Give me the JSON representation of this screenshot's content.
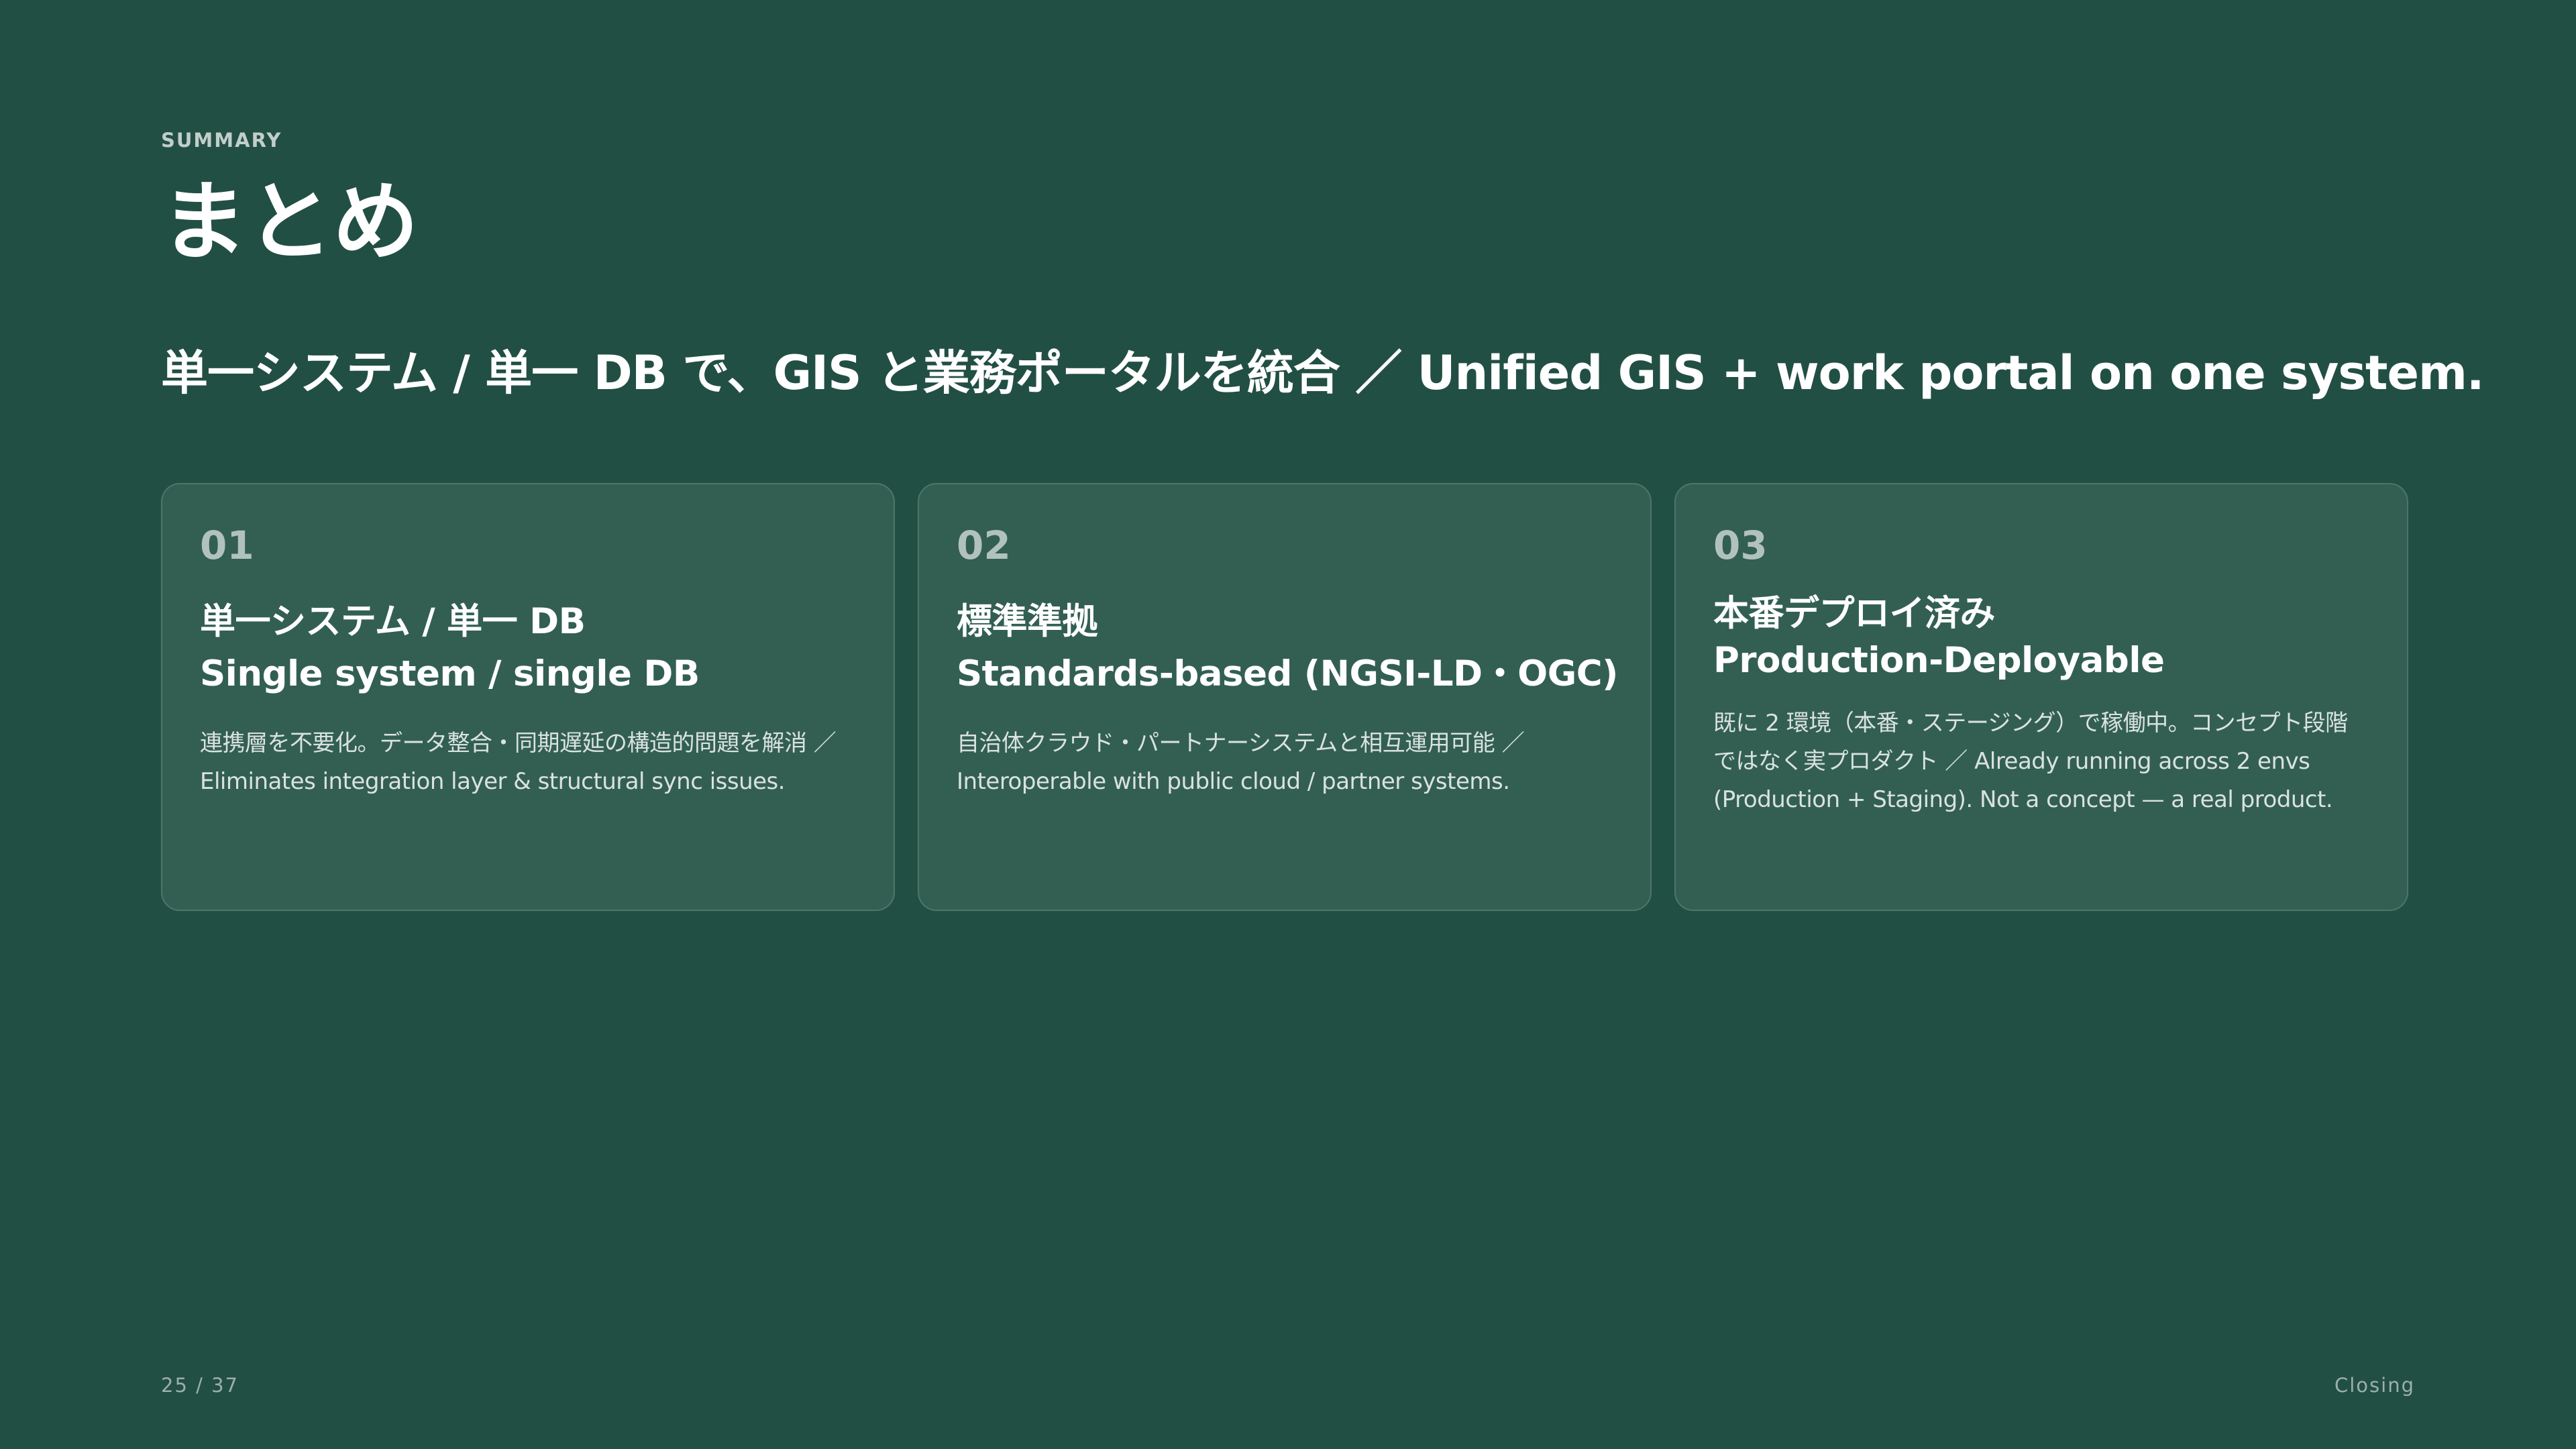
{
  "slide": {
    "eyebrow": "SUMMARY",
    "title": "まとめ",
    "headline": "単一システム / 単一 DB で、GIS と業務ポータルを統合 ／ Unified GIS + work portal on one system.",
    "cards": [
      {
        "number": "01",
        "title_ja": "単一システム / 単一 DB",
        "title_en": "Single system / single DB",
        "description": "連携層を不要化。データ整合・同期遅延の構造的問題を解消 ／ Eliminates integration layer & structural sync issues."
      },
      {
        "number": "02",
        "title_ja": "標準準拠",
        "title_en": "Standards-based (NGSI-LD・OGC)",
        "description": "自治体クラウド・パートナーシステムと相互運用可能 ／ Interoperable with public cloud / partner systems."
      },
      {
        "number": "03",
        "title_ja": "本番デプロイ済み",
        "title_en": "Production-Deployable",
        "description": "既に 2 環境（本番・ステージング）で稼働中。コンセプト段階ではなく実プロダクト ／ Already running across 2 envs (Production + Staging). Not a concept — a real product."
      }
    ],
    "footer": {
      "page": "25 / 37",
      "section": "Closing"
    }
  },
  "colors": {
    "background": "#224f43",
    "card_background": "#335f53",
    "card_border": "#4d7669",
    "text": "#ffffff"
  }
}
